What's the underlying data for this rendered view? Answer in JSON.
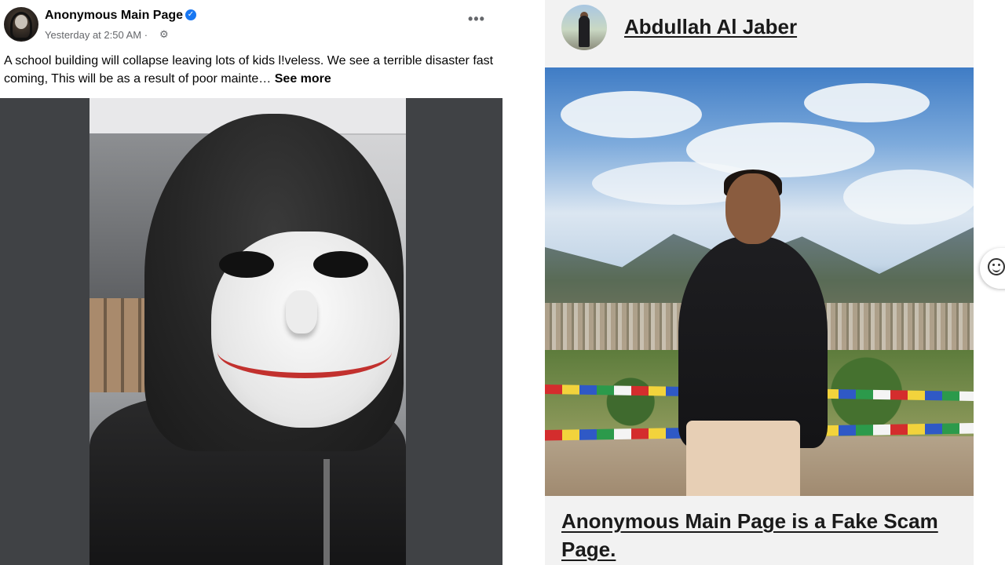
{
  "left_post": {
    "page_name": "Anonymous Main Page",
    "meta": "Yesterday at 2:50 AM ·",
    "text": "A school building will collapse leaving lots of kids l!veless. We see a terrible disaster fast coming, This will be as a result of poor mainte…",
    "see_more": "See more",
    "icons": {
      "verified": "verified-badge-icon",
      "audience": "gear-icon",
      "more": "more-options-icon"
    },
    "verified_glyph": "✓",
    "audience_glyph": "⚙",
    "more_glyph": "•••"
  },
  "right_card": {
    "profile_name": "Abdullah Al Jaber",
    "caption": "Anonymous Main Page is a Fake Scam Page."
  },
  "colors": {
    "facebook_blue": "#1877f2",
    "meta_gray": "#65676b",
    "card_background": "#f2f2f2"
  }
}
